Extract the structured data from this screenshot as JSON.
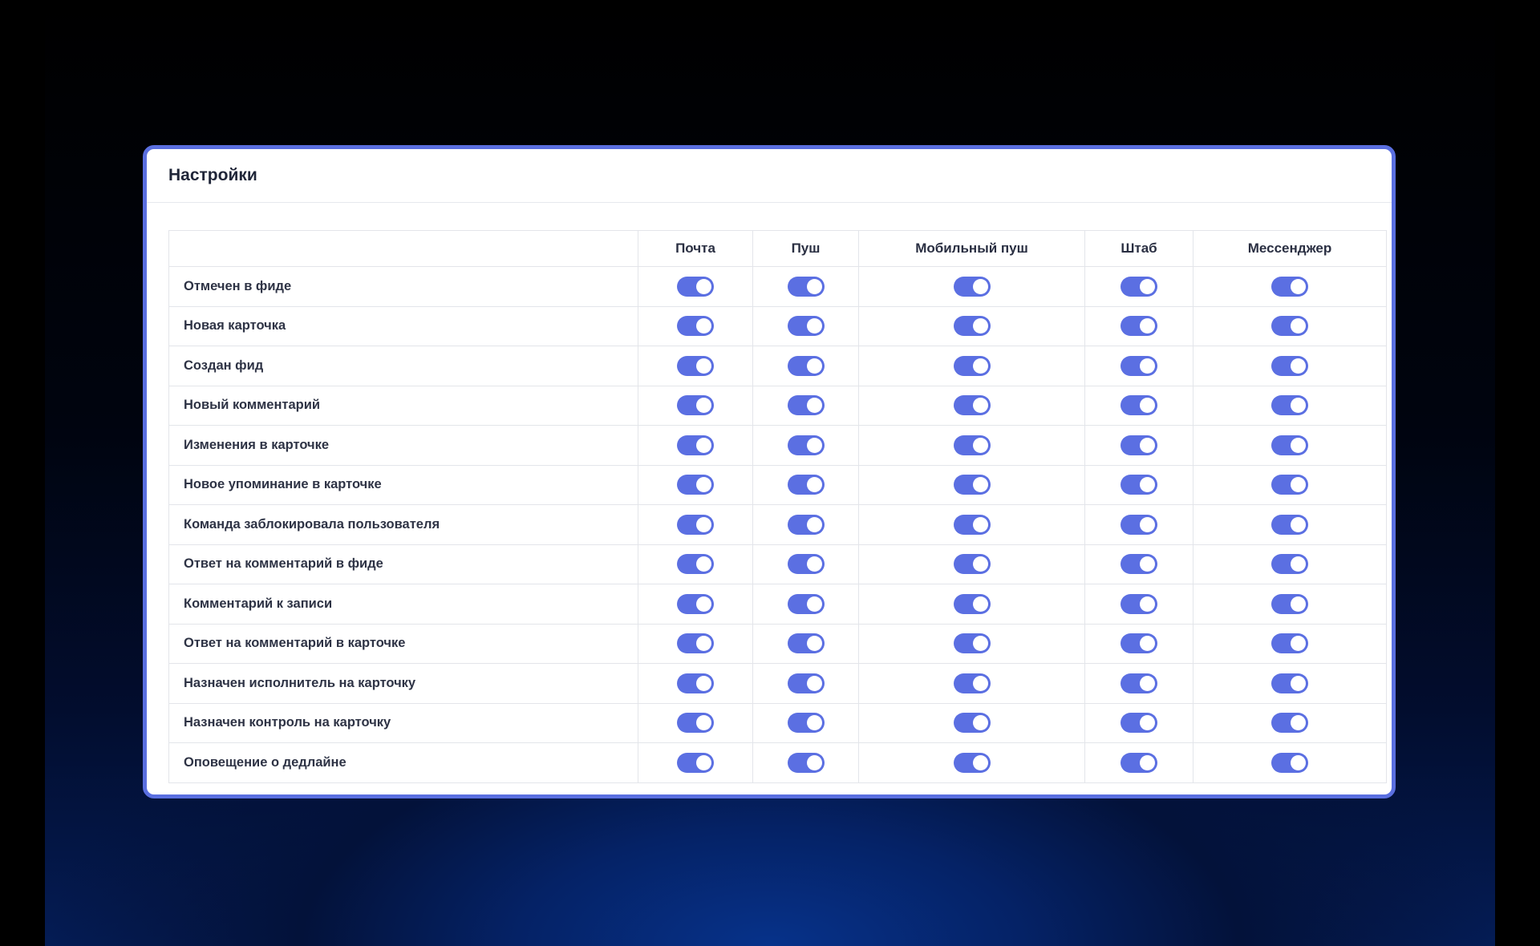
{
  "colors": {
    "accent": "#5b6fe2",
    "card_border": "#5a6fe0",
    "text": "#2e3345"
  },
  "settings": {
    "title": "Настройки",
    "columns": [
      "",
      "Почта",
      "Пуш",
      "Мобильный пуш",
      "Штаб",
      "Мессенджер"
    ],
    "rows": [
      {
        "label": "Отмечен в фиде",
        "toggles": [
          true,
          true,
          true,
          true,
          true
        ]
      },
      {
        "label": "Новая карточка",
        "toggles": [
          true,
          true,
          true,
          true,
          true
        ]
      },
      {
        "label": "Создан фид",
        "toggles": [
          true,
          true,
          true,
          true,
          true
        ]
      },
      {
        "label": "Новый комментарий",
        "toggles": [
          true,
          true,
          true,
          true,
          true
        ]
      },
      {
        "label": "Изменения в карточке",
        "toggles": [
          true,
          true,
          true,
          true,
          true
        ]
      },
      {
        "label": "Новое упоминание в карточке",
        "toggles": [
          true,
          true,
          true,
          true,
          true
        ]
      },
      {
        "label": "Команда заблокировала пользователя",
        "toggles": [
          true,
          true,
          true,
          true,
          true
        ]
      },
      {
        "label": "Ответ на комментарий в фиде",
        "toggles": [
          true,
          true,
          true,
          true,
          true
        ]
      },
      {
        "label": "Комментарий к записи",
        "toggles": [
          true,
          true,
          true,
          true,
          true
        ]
      },
      {
        "label": "Ответ на комментарий в карточке",
        "toggles": [
          true,
          true,
          true,
          true,
          true
        ]
      },
      {
        "label": "Назначен исполнитель на карточку",
        "toggles": [
          true,
          true,
          true,
          true,
          true
        ]
      },
      {
        "label": "Назначен контроль на карточку",
        "toggles": [
          true,
          true,
          true,
          true,
          true
        ]
      },
      {
        "label": "Оповещение о дедлайне",
        "toggles": [
          true,
          true,
          true,
          true,
          true
        ]
      }
    ]
  }
}
